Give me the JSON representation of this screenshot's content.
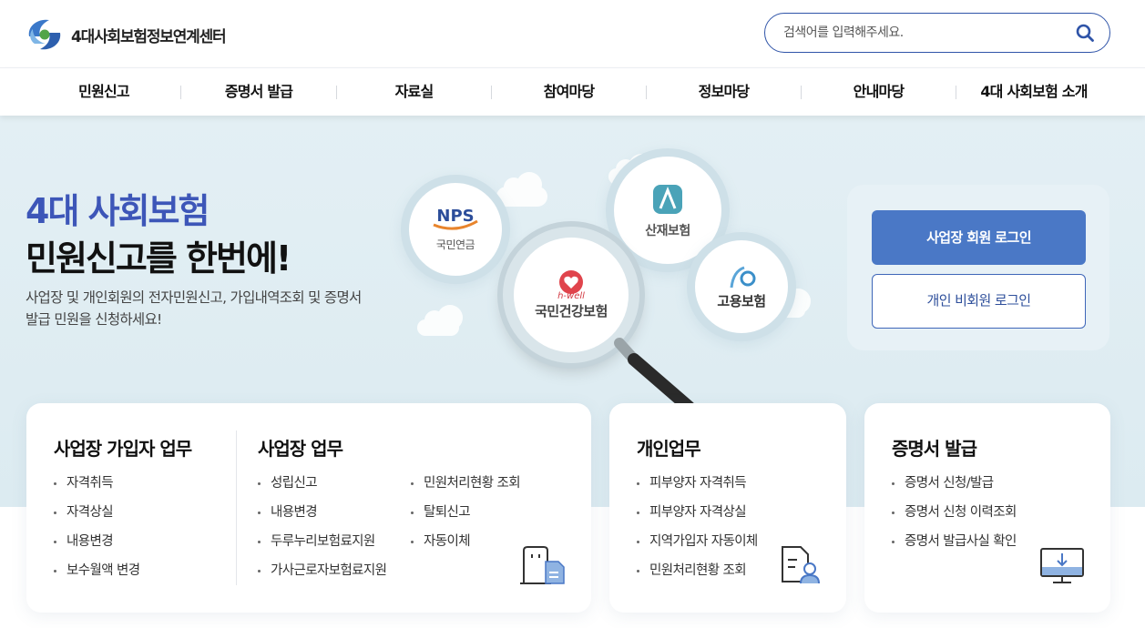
{
  "header": {
    "logo_text": "4대사회보험정보연계센터",
    "search_placeholder": "검색어를 입력해주세요."
  },
  "nav": [
    "민원신고",
    "증명서 발급",
    "자료실",
    "참여마당",
    "정보마당",
    "안내마당",
    "4대 사회보험 소개"
  ],
  "hero": {
    "line1": "4대 사회보험",
    "line2": "민원신고를 한번에!",
    "desc": "사업장 및 개인회원의 전자민원신고, 가입내역조회 및 증명서 발급 민원을 신청하세요!",
    "bubbles": {
      "nps_logo": "NPS",
      "nps_label": "국민연금",
      "sanjae_label": "산재보험",
      "goyong_label": "고용보험",
      "hwell_logo": "h-well",
      "health_label": "국민건강보험"
    },
    "login_corp": "사업장 회원 로그인",
    "login_indiv": "개인 비회원 로그인"
  },
  "cards": {
    "subscriber": {
      "title": "사업장 가입자 업무",
      "items": [
        "자격취득",
        "자격상실",
        "내용변경",
        "보수월액 변경"
      ]
    },
    "workplace": {
      "title": "사업장 업무",
      "col1": [
        "성립신고",
        "내용변경",
        "두루누리보험료지원",
        "가사근로자보험료지원"
      ],
      "col2": [
        "민원처리현황 조회",
        "탈퇴신고",
        "자동이체"
      ]
    },
    "personal": {
      "title": "개인업무",
      "items": [
        "피부양자 자격취득",
        "피부양자 자격상실",
        "지역가입자 자동이체",
        "민원처리현황 조회"
      ]
    },
    "certificate": {
      "title": "증명서 발급",
      "items": [
        "증명서 신청/발급",
        "증명서 신청 이력조회",
        "증명서 발급사실 확인"
      ]
    }
  },
  "colors": {
    "brand_blue": "#3d56b8",
    "button_blue": "#4a78c6",
    "hero_bg": "#e3eff4"
  }
}
